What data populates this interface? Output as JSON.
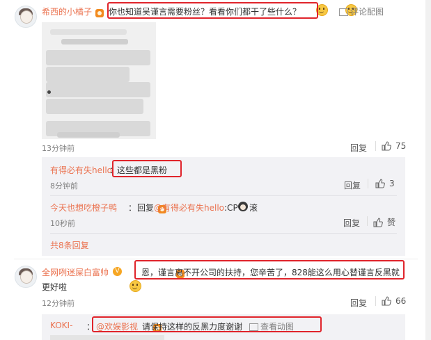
{
  "comments": [
    {
      "username": "希西的小橘子",
      "text": "你也知道吴谨言需要粉丝？看看你们都干了些什么？",
      "view_image": "评论配图",
      "time": "13分钟前",
      "reply_label": "回复",
      "likes": "75"
    },
    {
      "username": "全网咧迷屎白富帅",
      "text_line1": "恩，谨言离不开公司的扶持，您辛苦了，828能这么用心替谨言反黑就",
      "text_line2": "更好啦",
      "time": "12分钟前",
      "reply_label": "回复",
      "likes": "66"
    }
  ],
  "sub_replies": [
    {
      "username": "有得必有失hello",
      "separator": "：",
      "text": "这些都是黑粉",
      "time": "8分钟前",
      "reply_label": "回复",
      "likes": "3"
    },
    {
      "username": "今天也想吃橙子鸭",
      "separator": "：",
      "reply_prefix": "回复",
      "mention": "@有得必有失hello",
      "text_after": ":CP",
      "text_end": "滚",
      "time": "10秒前",
      "reply_label": "回复",
      "likes": "赞"
    }
  ],
  "more_replies": "共8条回复",
  "third": {
    "username": "KOKI-",
    "separator": "：",
    "mention": "@欢娱影视",
    "text": "请保持这样的反黑力度谢谢",
    "view_gif": "查看动图"
  },
  "colors": {
    "name": "#eb7350",
    "highlight": "#e0242b"
  }
}
